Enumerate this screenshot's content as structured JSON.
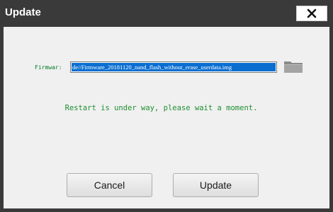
{
  "window": {
    "title": "Update",
    "close_icon": "close-x-icon"
  },
  "firmware": {
    "label": "Firmwar:",
    "path_value": "de//Firmware_20181120_nand_flash_without_erase_userdata.img",
    "browse_icon": "folder-icon"
  },
  "status": {
    "message": "Restart is under way, please wait a moment."
  },
  "buttons": {
    "cancel_label": "Cancel",
    "update_label": "Update"
  },
  "colors": {
    "titlebar": "#3a3a3a",
    "client_bg": "#f0f0f0",
    "status_text": "#1f8f32",
    "selection": "#0a6ed1"
  }
}
